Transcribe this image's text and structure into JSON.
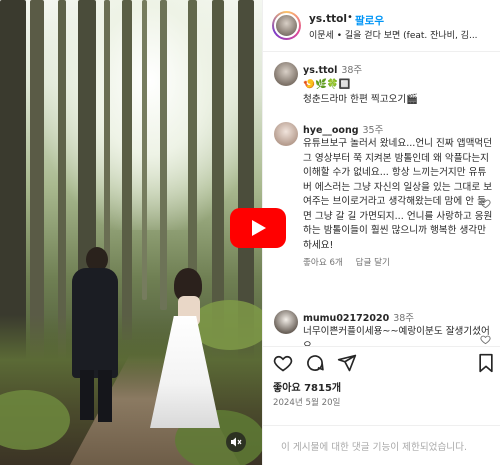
{
  "post": {
    "username": "ys.ttol",
    "separator": "•",
    "follow_label": "팔로우",
    "song": "이문세 • 길을 걷다 보면 (feat. 잔나비, 김..."
  },
  "comments": [
    {
      "username": "ys.ttol",
      "time": "38주",
      "lines": [
        "🍤🌿🍀🔲",
        "청춘드라마 한편 찍고오기🎬"
      ],
      "has_actions": false
    },
    {
      "username": "hye__oong",
      "time": "35주",
      "text": "유튜브보구 놀러서 왔네요...언니 진짜 앱맥먹던 그 영상부터 쭉 지켜본 밤톨인데 왜 악플다는지 이해할 수가 없네요... 항상 느끼는거지만 유튜버 에스러는 그냥 자신의 일상을 있는 그대로 보여주는 브이로거라고 생각해왔는데 맘에 안 들면 그냥 갈 길 가면되지... 언니를 사랑하고 응원하는 밤톨이들이 훨씬 많으니까 행복한 생각만 하세요!",
      "likes": "좋아요 6개",
      "reply": "답글 달기"
    },
    {
      "username": "mumu02172020",
      "time": "38주",
      "text": "너무이쁜커플이세용~~예랑이분도 잘생기셨어요",
      "likes": "",
      "reply": ""
    }
  ],
  "stats": {
    "likes": "좋아요 7815개",
    "date": "2024년 5월 20일"
  },
  "footer": {
    "message": "이 게시물에 대한 댓글 기능이 제한되었습니다."
  },
  "icons": {
    "play": "play-icon",
    "mute": "mute-icon",
    "heart": "heart-icon",
    "comment": "comment-icon",
    "share": "send-icon",
    "save": "bookmark-icon"
  },
  "colors": {
    "accent": "#0095f6",
    "youtube": "#ff0000"
  }
}
